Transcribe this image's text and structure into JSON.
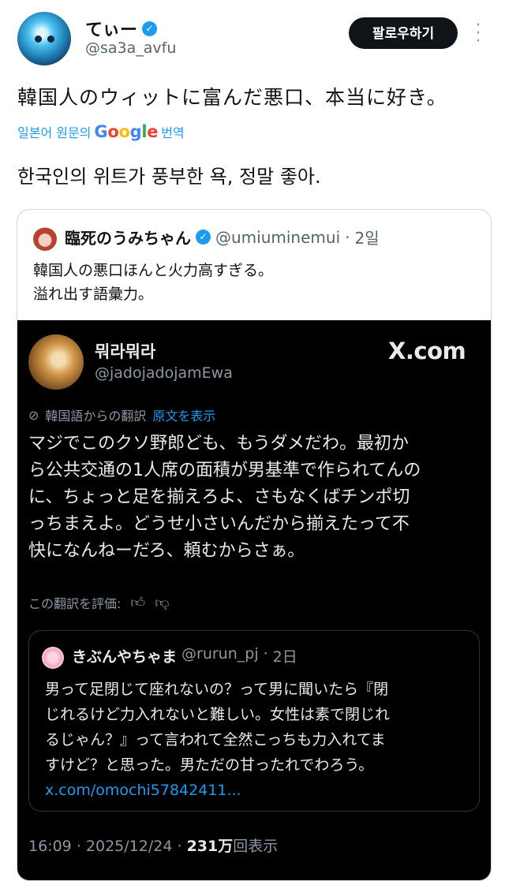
{
  "author": {
    "name": "てぃー",
    "handle": "@sa3a_avfu",
    "verified_icon": "verified-badge-icon"
  },
  "follow_button": "팔로우하기",
  "more_icon": "more-vertical-icon",
  "tweet_text": "韓国人のウィットに富んだ悪口、本当に好き。",
  "translate": {
    "prefix": "일본어 원문의",
    "google": [
      "G",
      "o",
      "o",
      "g",
      "l",
      "e"
    ],
    "suffix": "번역",
    "translated_text": "한국인의 위트가 풍부한 욕, 정말 좋아."
  },
  "quote": {
    "name": "臨死のうみちゃん",
    "handle": "@umiuminemui",
    "dot": "·",
    "time": "2일",
    "text_lines": [
      "韓国人の悪口ほんと火力高すぎる。",
      "溢れ出す語彙力。"
    ],
    "embedded": {
      "name": "뭐라뭐라",
      "handle": "@jadojadojamEwa",
      "logo": "X.com",
      "translated_from": "韓国語からの翻訳",
      "show_original": "原文を表示",
      "text_lines": [
        "マジでこのクソ野郎ども、もうダメだわ。最初か",
        "ら公共交通の1人席の面積が男基準で作られてんの",
        "に、ちょっと足を揃えろよ、さもなくばチンポ切",
        "っちまえよ。どうせ小さいんだから揃えたって不",
        "快になんねーだろ、頼むからさぁ。"
      ],
      "rate_label": "この翻訳を評価:",
      "nested": {
        "name": "きぶんやちゃま",
        "handle": "@rurun_pj",
        "dot": "·",
        "time": "2日",
        "text_lines": [
          "男って足閉じて座れないの？って男に聞いたら『閉",
          "じれるけど力入れないと難しい。女性は素で閉じれ",
          "るじゃん？』って言われて全然こっちも力入れてま",
          "すけど？と思った。男ただの甘ったれでわろう。"
        ],
        "link": "x.com/omochi57842411..."
      },
      "footer": {
        "time": "16:09",
        "dot": "·",
        "date": "2025/12/24",
        "views": "231万",
        "views_label": "回表示"
      }
    }
  }
}
